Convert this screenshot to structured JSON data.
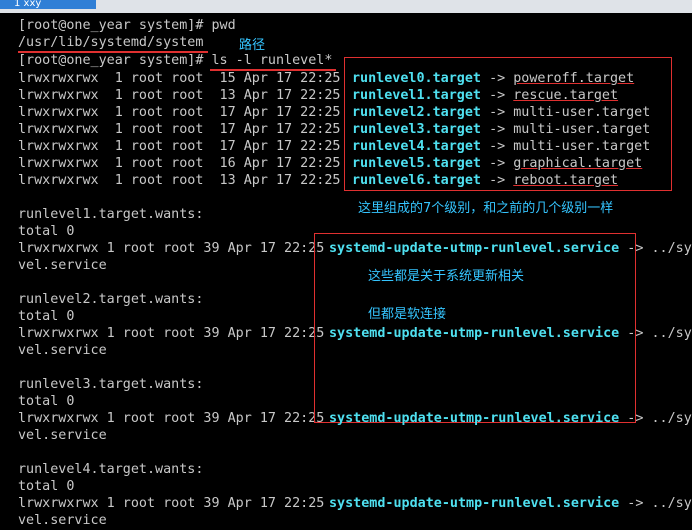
{
  "window": {
    "tab_title": "1 xxy"
  },
  "terminal": {
    "lines": [
      "[root@one_year system]# pwd",
      "/usr/lib/systemd/system",
      "[root@one_year system]# ls -l runlevel*",
      "lrwxrwxrwx  1 root root  15 Apr 17 22:25",
      "lrwxrwxrwx  1 root root  13 Apr 17 22:25",
      "lrwxrwxrwx  1 root root  17 Apr 17 22:25",
      "lrwxrwxrwx  1 root root  17 Apr 17 22:25",
      "lrwxrwxrwx  1 root root  17 Apr 17 22:25",
      "lrwxrwxrwx  1 root root  16 Apr 17 22:25",
      "lrwxrwxrwx  1 root root  13 Apr 17 22:25",
      "runlevel1.target.wants:",
      "total 0",
      "lrwxrwxrwx 1 root root 39 Apr 17 22:25",
      "vel.service",
      "runlevel2.target.wants:",
      "total 0",
      "lrwxrwxrwx 1 root root 39 Apr 17 22:25",
      "vel.service",
      "runlevel3.target.wants:",
      "total 0",
      "lrwxrwxrwx 1 root root 39 Apr 17 22:25",
      "vel.service",
      "runlevel4.target.wants:",
      "total 0",
      "lrwxrwxrwx 1 root root 39 Apr 17 22:25",
      "vel.service"
    ],
    "targets": [
      {
        "name": "runlevel0.target",
        "dest": "poweroff.target"
      },
      {
        "name": "runlevel1.target",
        "dest": "rescue.target"
      },
      {
        "name": "runlevel2.target",
        "dest": "multi-user.target"
      },
      {
        "name": "runlevel3.target",
        "dest": "multi-user.target"
      },
      {
        "name": "runlevel4.target",
        "dest": "multi-user.target"
      },
      {
        "name": "runlevel5.target",
        "dest": "graphical.target"
      },
      {
        "name": "runlevel6.target",
        "dest": "reboot.target"
      }
    ],
    "arrow": "->",
    "service_name": "systemd-update-utmp-runlevel.service",
    "service_dest": "../sys",
    "annotations": {
      "path": "路径",
      "levels": "这里组成的7个级别，和之前的几个级别一样",
      "update": "这些都是关于系统更新相关",
      "softlink": "但都是软连接"
    }
  }
}
